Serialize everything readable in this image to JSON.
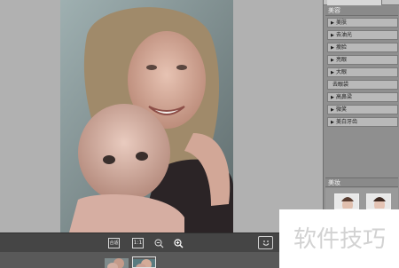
{
  "toolbar": {
    "fit_label": "合适",
    "actual_size_label": "1:1",
    "zoom_out_label": "−",
    "zoom_in_label": "+"
  },
  "panel": {
    "section_title": "美容",
    "items": [
      {
        "label": "美肤",
        "has_arrow": true
      },
      {
        "label": "去油光",
        "has_arrow": true
      },
      {
        "label": "瘦脸",
        "has_arrow": true
      },
      {
        "label": "亮眼",
        "has_arrow": true
      },
      {
        "label": "大眼",
        "has_arrow": true
      },
      {
        "label": "去眼袋",
        "has_arrow": false
      },
      {
        "label": "高鼻梁",
        "has_arrow": true
      },
      {
        "label": "微笑",
        "has_arrow": true
      },
      {
        "label": "美白牙齿",
        "has_arrow": true
      }
    ],
    "makeup_title": "美妆"
  },
  "watermark": {
    "text": "软件技巧"
  },
  "colors": {
    "canvas_bg": "#b1b1b1",
    "toolbar_bg": "#454545",
    "panel_bg": "#8f8f8f",
    "item_bg": "#b9b9b9"
  }
}
